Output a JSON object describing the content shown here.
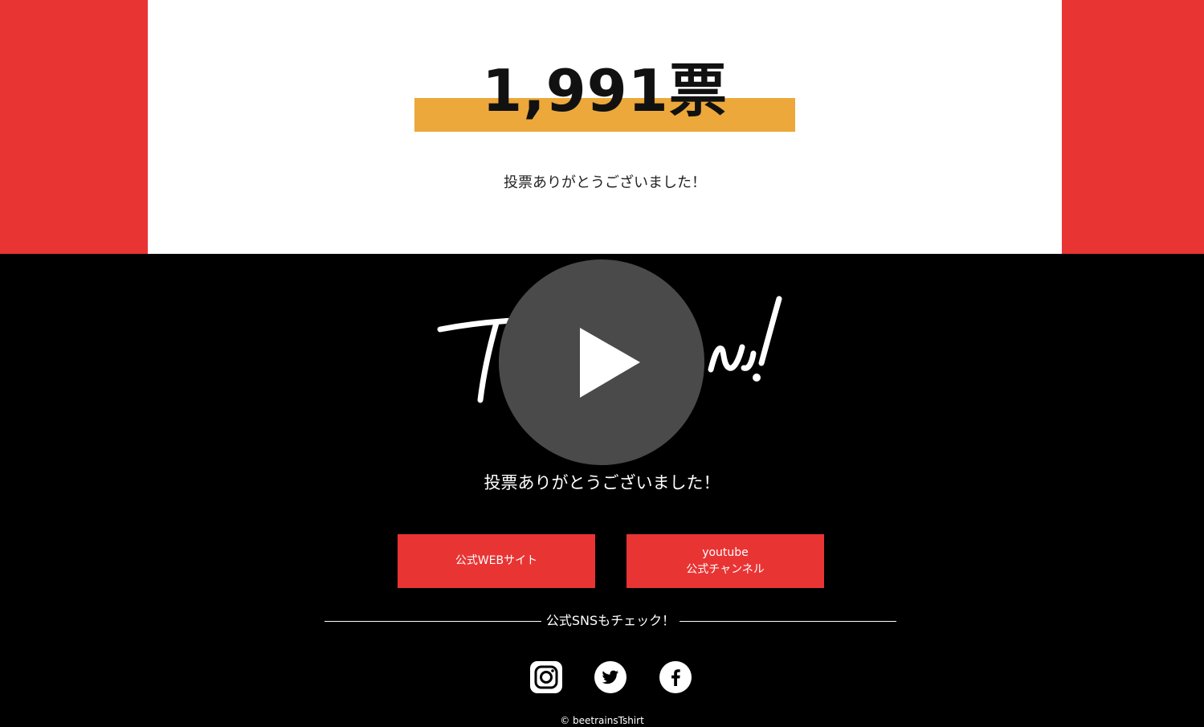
{
  "result": {
    "votes": "1,991票",
    "message": "投票ありがとうございました！"
  },
  "video": {
    "script_text": "Thank you!",
    "play_icon": "play-icon",
    "message": "投票ありがとうございました！"
  },
  "buttons": {
    "official_web": "公式WEBサイト",
    "youtube_line1": "youtube",
    "youtube_line2": "公式チャンネル"
  },
  "sns": {
    "heading": "公式SNSもチェック！",
    "icons": [
      "instagram-icon",
      "twitter-icon",
      "facebook-icon"
    ]
  },
  "footer": {
    "copyright": "© beetrainsTshirt"
  },
  "colors": {
    "red": "#e93434",
    "highlight": "#eca83a",
    "play_circle": "#4a4a4a"
  }
}
